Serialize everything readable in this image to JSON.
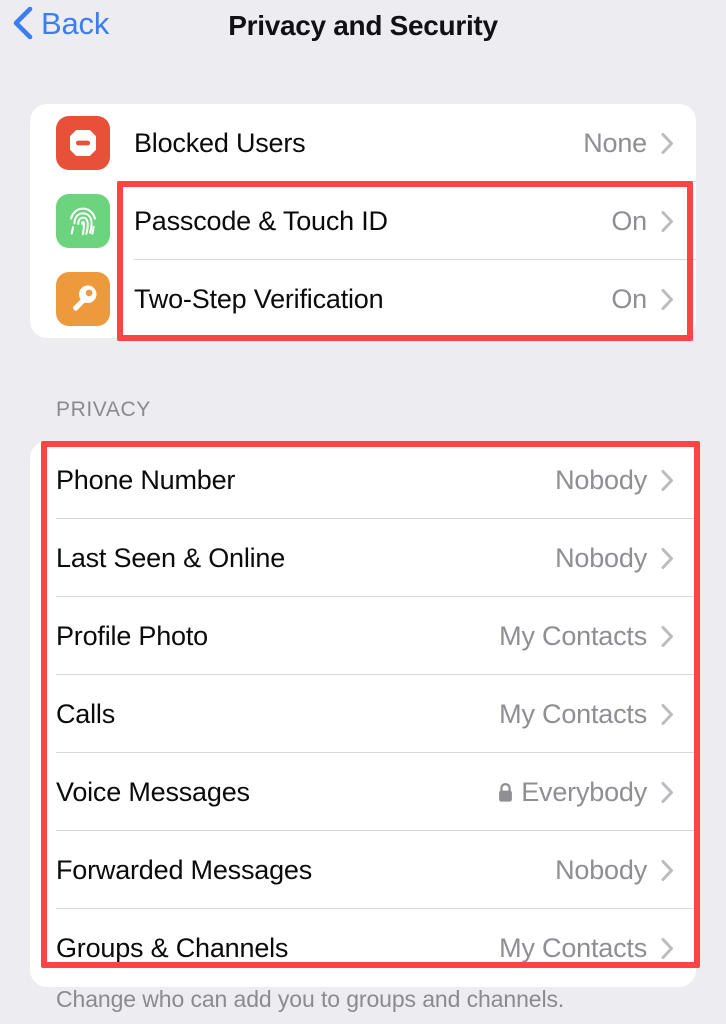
{
  "navbar": {
    "back_label": "Back",
    "back_icon": "chevron-left-icon",
    "title": "Privacy and Security",
    "back_color": "#3b7ef3"
  },
  "security_section": {
    "rows": [
      {
        "label": "Blocked Users",
        "value": "None",
        "icon": "block-user-icon",
        "icon_color": "#e8503a",
        "has_lock": false
      },
      {
        "label": "Passcode & Touch ID",
        "value": "On",
        "icon": "fingerprint-icon",
        "icon_color": "#6cd47e",
        "has_lock": false
      },
      {
        "label": "Two-Step Verification",
        "value": "On",
        "icon": "key-icon",
        "icon_color": "#ed9a3d",
        "has_lock": false
      }
    ]
  },
  "privacy_section": {
    "header": "PRIVACY",
    "footer": "Change who can add you to groups and channels.",
    "rows": [
      {
        "label": "Phone Number",
        "value": "Nobody",
        "has_lock": false
      },
      {
        "label": "Last Seen & Online",
        "value": "Nobody",
        "has_lock": false
      },
      {
        "label": "Profile Photo",
        "value": "My Contacts",
        "has_lock": false
      },
      {
        "label": "Calls",
        "value": "My Contacts",
        "has_lock": false
      },
      {
        "label": "Voice Messages",
        "value": "Everybody",
        "has_lock": true
      },
      {
        "label": "Forwarded Messages",
        "value": "Nobody",
        "has_lock": false
      },
      {
        "label": "Groups & Channels",
        "value": "My Contacts",
        "has_lock": false
      }
    ]
  },
  "annotations": {
    "color": "#fc4444",
    "boxes": [
      {
        "name": "highlight-security-rows"
      },
      {
        "name": "highlight-privacy-rows"
      }
    ]
  }
}
